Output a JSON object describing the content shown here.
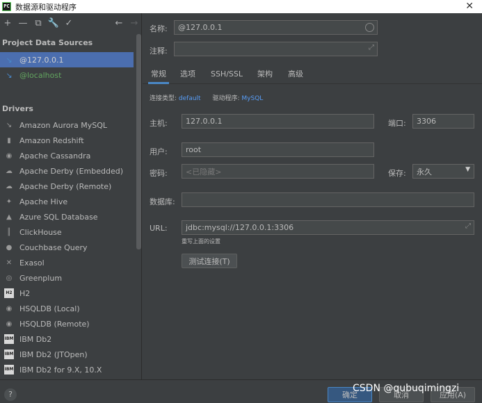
{
  "window": {
    "title": "数据源和驱动程序",
    "app_icon": "PC"
  },
  "toolbar": {
    "add_icon": "+",
    "remove_icon": "—",
    "duplicate_icon": "⧉",
    "settings_icon": "🔧",
    "check_icon": "✓",
    "back_icon": "←",
    "forward_icon": "→"
  },
  "sidebar": {
    "data_sources_title": "Project Data Sources",
    "data_sources": [
      {
        "label": "@127.0.0.1"
      },
      {
        "label": "@localhost"
      }
    ],
    "drivers_title": "Drivers",
    "drivers": [
      {
        "label": "Amazon Aurora MySQL",
        "icon": "↘"
      },
      {
        "label": "Amazon Redshift",
        "icon": "▮"
      },
      {
        "label": "Apache Cassandra",
        "icon": "◉"
      },
      {
        "label": "Apache Derby (Embedded)",
        "icon": "☁"
      },
      {
        "label": "Apache Derby (Remote)",
        "icon": "☁"
      },
      {
        "label": "Apache Hive",
        "icon": "✦"
      },
      {
        "label": "Azure SQL Database",
        "icon": "▲"
      },
      {
        "label": "ClickHouse",
        "icon": "║"
      },
      {
        "label": "Couchbase Query",
        "icon": "●"
      },
      {
        "label": "Exasol",
        "icon": "✕"
      },
      {
        "label": "Greenplum",
        "icon": "◎"
      },
      {
        "label": "H2",
        "icon": "H2"
      },
      {
        "label": "HSQLDB (Local)",
        "icon": "◉"
      },
      {
        "label": "HSQLDB (Remote)",
        "icon": "◉"
      },
      {
        "label": "IBM Db2",
        "icon": "IBM"
      },
      {
        "label": "IBM Db2 (JTOpen)",
        "icon": "IBM"
      },
      {
        "label": "IBM Db2 for 9.X, 10.X",
        "icon": "IBM"
      }
    ]
  },
  "form": {
    "name_label": "名称:",
    "name_value": "@127.0.0.1",
    "comment_label": "注释:",
    "comment_value": "",
    "tabs": [
      {
        "label": "常规"
      },
      {
        "label": "选项"
      },
      {
        "label": "SSH/SSL"
      },
      {
        "label": "架构"
      },
      {
        "label": "高级"
      }
    ],
    "connection_type_label": "连接类型:",
    "connection_type_value": "default",
    "driver_label": "驱动程序:",
    "driver_value": "MySQL",
    "host_label": "主机:",
    "host_value": "127.0.0.1",
    "port_label": "端口:",
    "port_value": "3306",
    "user_label": "用户:",
    "user_value": "root",
    "password_label": "密码:",
    "password_placeholder": "<已隐藏>",
    "save_label": "保存:",
    "save_value": "永久",
    "database_label": "数据库:",
    "database_value": "",
    "url_label": "URL:",
    "url_value": "jdbc:mysql://127.0.0.1:3306",
    "url_hint": "重写上面的设置",
    "test_button": "测试连接(T)"
  },
  "footer": {
    "help": "?",
    "ok_button": "确定",
    "cancel_button": "取消",
    "apply_button": "应用(A)"
  },
  "watermark": "CSDN @qubuqimingzi",
  "colors": {
    "accent": "#4a88c7",
    "selection": "#4b6eaf",
    "link": "#589df6",
    "background": "#3c3f41"
  }
}
